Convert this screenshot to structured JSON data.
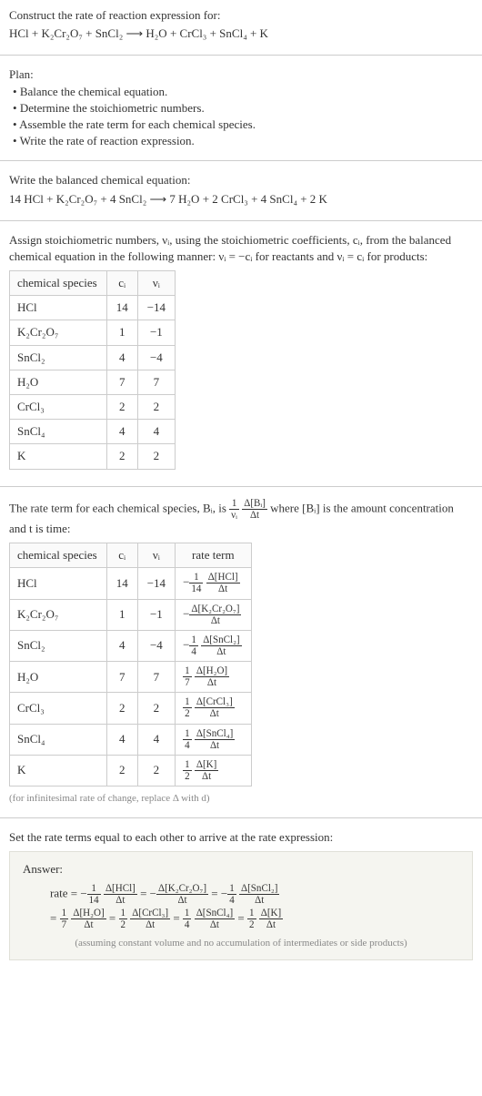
{
  "prompt": {
    "title": "Construct the rate of reaction expression for:",
    "equation": "HCl + K₂Cr₂O₇ + SnCl₂  ⟶  H₂O + CrCl₃ + SnCl₄ + K"
  },
  "plan": {
    "heading": "Plan:",
    "items": [
      "Balance the chemical equation.",
      "Determine the stoichiometric numbers.",
      "Assemble the rate term for each chemical species.",
      "Write the rate of reaction expression."
    ]
  },
  "balanced": {
    "heading": "Write the balanced chemical equation:",
    "equation": "14 HCl + K₂Cr₂O₇ + 4 SnCl₂  ⟶  7 H₂O + 2 CrCl₃ + 4 SnCl₄ + 2 K"
  },
  "stoich": {
    "intro_a": "Assign stoichiometric numbers, νᵢ, using the stoichiometric coefficients, cᵢ, from the balanced chemical equation in the following manner: νᵢ = −cᵢ for reactants and νᵢ = cᵢ for products:",
    "headers": {
      "species": "chemical species",
      "c": "cᵢ",
      "v": "νᵢ"
    },
    "rows": [
      {
        "species": "HCl",
        "c": "14",
        "v": "−14"
      },
      {
        "species": "K₂Cr₂O₇",
        "c": "1",
        "v": "−1"
      },
      {
        "species": "SnCl₂",
        "c": "4",
        "v": "−4"
      },
      {
        "species": "H₂O",
        "c": "7",
        "v": "7"
      },
      {
        "species": "CrCl₃",
        "c": "2",
        "v": "2"
      },
      {
        "species": "SnCl₄",
        "c": "4",
        "v": "4"
      },
      {
        "species": "K",
        "c": "2",
        "v": "2"
      }
    ]
  },
  "rateterm": {
    "intro_a": "The rate term for each chemical species, Bᵢ, is ",
    "intro_b": " where [Bᵢ] is the amount concentration and t is time:",
    "frac1_num": "1",
    "frac1_den": "νᵢ",
    "frac2_num": "Δ[Bᵢ]",
    "frac2_den": "Δt",
    "headers": {
      "species": "chemical species",
      "c": "cᵢ",
      "v": "νᵢ",
      "rt": "rate term"
    },
    "rows": [
      {
        "species": "HCl",
        "c": "14",
        "v": "−14",
        "neg": "−",
        "coef_num": "1",
        "coef_den": "14",
        "d_num": "Δ[HCl]",
        "d_den": "Δt"
      },
      {
        "species": "K₂Cr₂O₇",
        "c": "1",
        "v": "−1",
        "neg": "−",
        "coef_num": "",
        "coef_den": "",
        "d_num": "Δ[K₂Cr₂O₇]",
        "d_den": "Δt"
      },
      {
        "species": "SnCl₂",
        "c": "4",
        "v": "−4",
        "neg": "−",
        "coef_num": "1",
        "coef_den": "4",
        "d_num": "Δ[SnCl₂]",
        "d_den": "Δt"
      },
      {
        "species": "H₂O",
        "c": "7",
        "v": "7",
        "neg": "",
        "coef_num": "1",
        "coef_den": "7",
        "d_num": "Δ[H₂O]",
        "d_den": "Δt"
      },
      {
        "species": "CrCl₃",
        "c": "2",
        "v": "2",
        "neg": "",
        "coef_num": "1",
        "coef_den": "2",
        "d_num": "Δ[CrCl₃]",
        "d_den": "Δt"
      },
      {
        "species": "SnCl₄",
        "c": "4",
        "v": "4",
        "neg": "",
        "coef_num": "1",
        "coef_den": "4",
        "d_num": "Δ[SnCl₄]",
        "d_den": "Δt"
      },
      {
        "species": "K",
        "c": "2",
        "v": "2",
        "neg": "",
        "coef_num": "1",
        "coef_den": "2",
        "d_num": "Δ[K]",
        "d_den": "Δt"
      }
    ],
    "note": "(for infinitesimal rate of change, replace Δ with d)"
  },
  "final": {
    "heading": "Set the rate terms equal to each other to arrive at the rate expression:",
    "answer_label": "Answer:",
    "rate_word": "rate",
    "line1": [
      {
        "pre": " = −",
        "cn": "1",
        "cd": "14",
        "dn": "Δ[HCl]",
        "dd": "Δt"
      },
      {
        "pre": " = −",
        "cn": "",
        "cd": "",
        "dn": "Δ[K₂Cr₂O₇]",
        "dd": "Δt"
      },
      {
        "pre": " = −",
        "cn": "1",
        "cd": "4",
        "dn": "Δ[SnCl₂]",
        "dd": "Δt"
      }
    ],
    "line2": [
      {
        "pre": " = ",
        "cn": "1",
        "cd": "7",
        "dn": "Δ[H₂O]",
        "dd": "Δt"
      },
      {
        "pre": " = ",
        "cn": "1",
        "cd": "2",
        "dn": "Δ[CrCl₃]",
        "dd": "Δt"
      },
      {
        "pre": " = ",
        "cn": "1",
        "cd": "4",
        "dn": "Δ[SnCl₄]",
        "dd": "Δt"
      },
      {
        "pre": " = ",
        "cn": "1",
        "cd": "2",
        "dn": "Δ[K]",
        "dd": "Δt"
      }
    ],
    "note": "(assuming constant volume and no accumulation of intermediates or side products)"
  }
}
